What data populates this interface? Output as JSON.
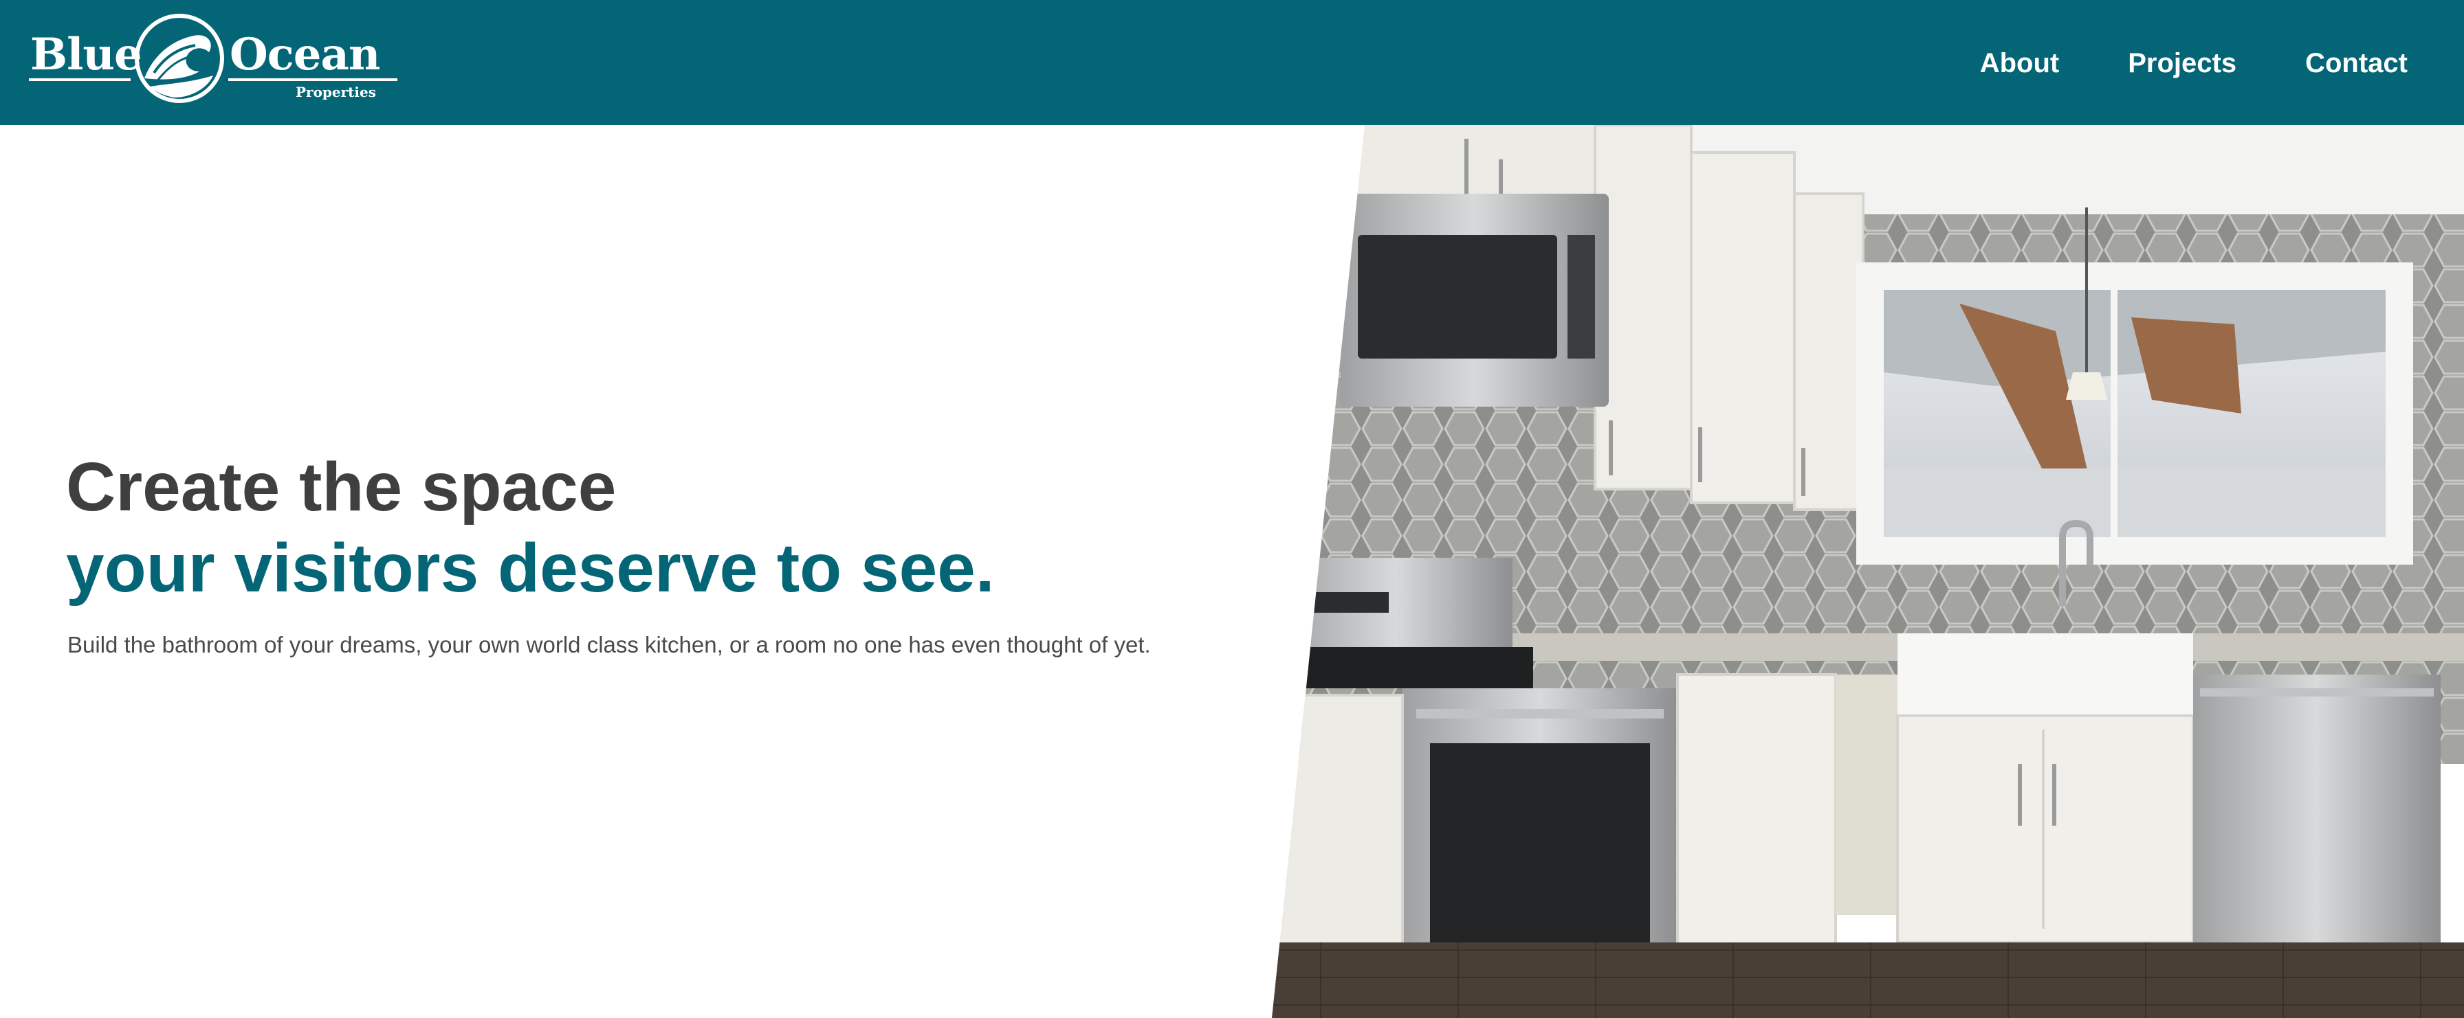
{
  "brand": {
    "word_left": "Blue",
    "word_right": "Ocean",
    "sub": "Properties"
  },
  "nav": {
    "items": [
      {
        "label": "About"
      },
      {
        "label": "Projects"
      },
      {
        "label": "Contact"
      }
    ]
  },
  "hero": {
    "headline_line1": "Create the space",
    "headline_line2": "your visitors deserve to see.",
    "subtext": "Build the bathroom of your dreams, your own world class kitchen, or a room no one has even thought of yet."
  },
  "colors": {
    "brand_teal": "#046577",
    "heading_gray": "#3f3f3f",
    "body_gray": "#4a4a4a"
  },
  "icons": {
    "logo_emblem": "wave-icon"
  }
}
